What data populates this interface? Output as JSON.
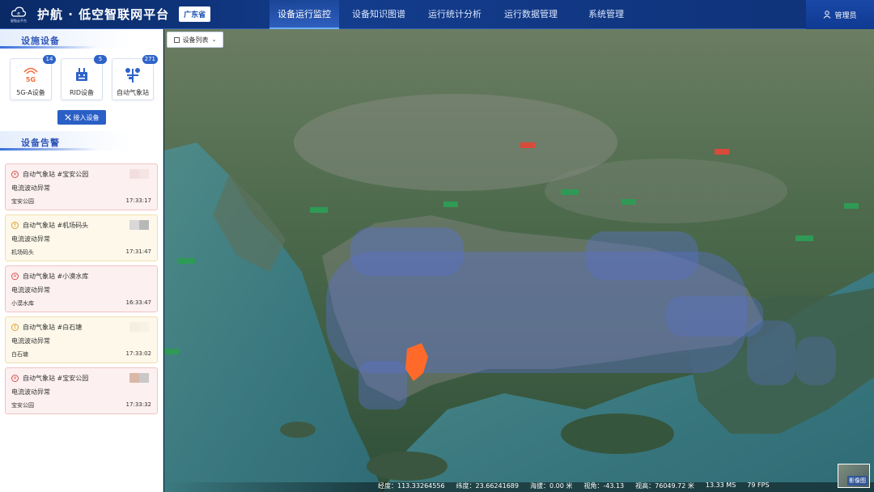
{
  "header": {
    "logo_subtext": "星链云平台",
    "title": "护航 · 低空智联网平台",
    "region": "广东省",
    "nav": [
      {
        "label": "设备运行监控",
        "active": true
      },
      {
        "label": "设备知识图谱",
        "active": false
      },
      {
        "label": "运行统计分析",
        "active": false
      },
      {
        "label": "运行数据管理",
        "active": false
      },
      {
        "label": "系统管理",
        "active": false
      }
    ],
    "user": "管理员"
  },
  "devices": {
    "section_title": "设施设备",
    "cards": [
      {
        "label": "5G-A设备",
        "count": "14",
        "icon": "5g-signal-icon"
      },
      {
        "label": "RID设备",
        "count": "5",
        "icon": "rid-device-icon"
      },
      {
        "label": "自动气象站",
        "count": "271",
        "icon": "weather-station-icon"
      }
    ],
    "connect_button": "接入设备"
  },
  "alarms": {
    "section_title": "设备告警",
    "items": [
      {
        "level": "error",
        "title": "自动气象站 #宝安公园",
        "desc": "电流波动异常",
        "location": "宝安公园",
        "time": "17:33:17"
      },
      {
        "level": "warn",
        "title": "自动气象站 #机场码头",
        "desc": "电流波动异常",
        "location": "机场码头",
        "time": "17:31:47"
      },
      {
        "level": "error",
        "title": "自动气象站 #小漠水库",
        "desc": "电流波动异常",
        "location": "小漠水库",
        "time": "16:33:47"
      },
      {
        "level": "warn",
        "title": "自动气象站 #白石塘",
        "desc": "电流波动异常",
        "location": "白石塘",
        "time": "17:33:02"
      },
      {
        "level": "error",
        "title": "自动气象站 #宝安公园",
        "desc": "电流波动异常",
        "location": "宝安公园",
        "time": "17:33:32"
      }
    ]
  },
  "map": {
    "list_button": "设备列表",
    "status": {
      "lon": "经度：113.33264556",
      "lat": "纬度：23.66241689",
      "alt": "海拔：0.00 米",
      "pitch": "视角：-43.13",
      "height": "视高：76049.72 米",
      "ms": "13.33 MS",
      "fps": "79 FPS"
    },
    "image_layer_label": "影像图"
  },
  "colors": {
    "accent": "#2a5fc6",
    "header_bg": "#0f3278",
    "marker": "#5a72d6",
    "hotspot": "#ff6a2a",
    "error": "#d9534f",
    "warn": "#e0a030"
  }
}
